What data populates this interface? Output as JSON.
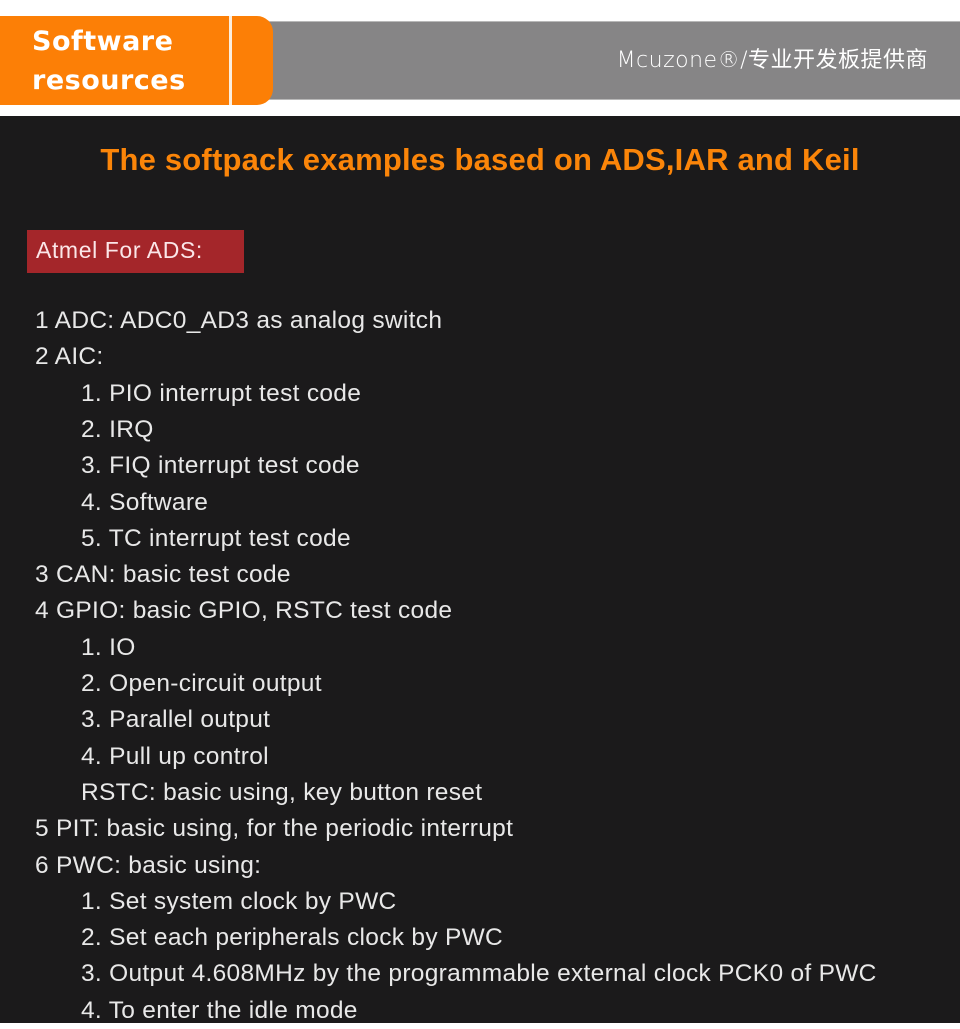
{
  "header": {
    "section_title_line1": "Software",
    "section_title_line2": "resources",
    "brand": "Mcuzone®/专业开发板提供商",
    "colors": {
      "orange": "#fc7f06",
      "gray": "#868586"
    }
  },
  "main": {
    "headline": "The softpack examples based on ADS,IAR and Keil",
    "label": "Atmel For ADS:",
    "colors": {
      "background": "#1b1a1b",
      "headline": "#fb8509",
      "label_bg": "#a4262a",
      "text": "#e8e8e8"
    },
    "lines": [
      {
        "level": 0,
        "text": "1 ADC: ADC0_AD3 as analog switch"
      },
      {
        "level": 0,
        "text": "2 AIC:"
      },
      {
        "level": 1,
        "text": "1. PIO interrupt test code"
      },
      {
        "level": 1,
        "text": "2. IRQ"
      },
      {
        "level": 1,
        "text": "3. FIQ interrupt test code"
      },
      {
        "level": 1,
        "text": "4. Software"
      },
      {
        "level": 1,
        "text": "5. TC interrupt test code"
      },
      {
        "level": 0,
        "text": "3 CAN: basic test code"
      },
      {
        "level": 0,
        "text": "4 GPIO: basic GPIO, RSTC test code"
      },
      {
        "level": 1,
        "text": "1. IO"
      },
      {
        "level": 1,
        "text": "2. Open-circuit output"
      },
      {
        "level": 1,
        "text": "3. Parallel output"
      },
      {
        "level": 1,
        "text": "4. Pull up control"
      },
      {
        "level": 1,
        "text": "RSTC: basic using, key button reset"
      },
      {
        "level": 0,
        "text": "5 PIT: basic using, for the periodic interrupt"
      },
      {
        "level": 0,
        "text": "6 PWC: basic using:"
      },
      {
        "level": 1,
        "text": "1. Set system clock by PWC"
      },
      {
        "level": 1,
        "text": "2. Set each peripherals clock by PWC"
      },
      {
        "level": 1,
        "text": "3. Output 4.608MHz by the programmable external clock PCK0 of PWC"
      },
      {
        "level": 1,
        "text": "4. To enter the idle mode"
      }
    ]
  }
}
